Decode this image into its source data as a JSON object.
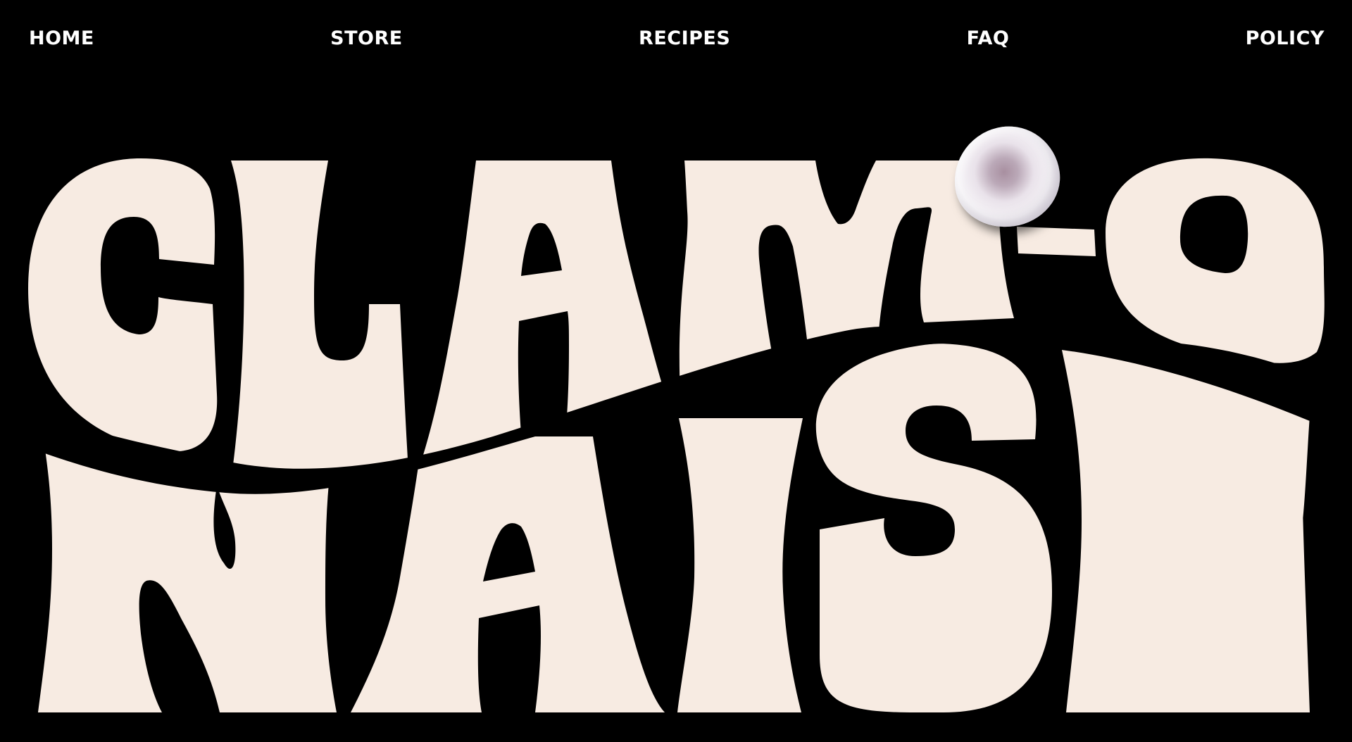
{
  "nav": {
    "items": [
      {
        "label": "HOME"
      },
      {
        "label": "STORE"
      },
      {
        "label": "RECIPES"
      },
      {
        "label": "FAQ"
      },
      {
        "label": "POLICY"
      }
    ]
  },
  "hero": {
    "line1": "CLAM-O",
    "line2": "NAISE",
    "letter_color": "#F7EBE2",
    "background_color": "#000000",
    "decoration": "pearl-image"
  }
}
